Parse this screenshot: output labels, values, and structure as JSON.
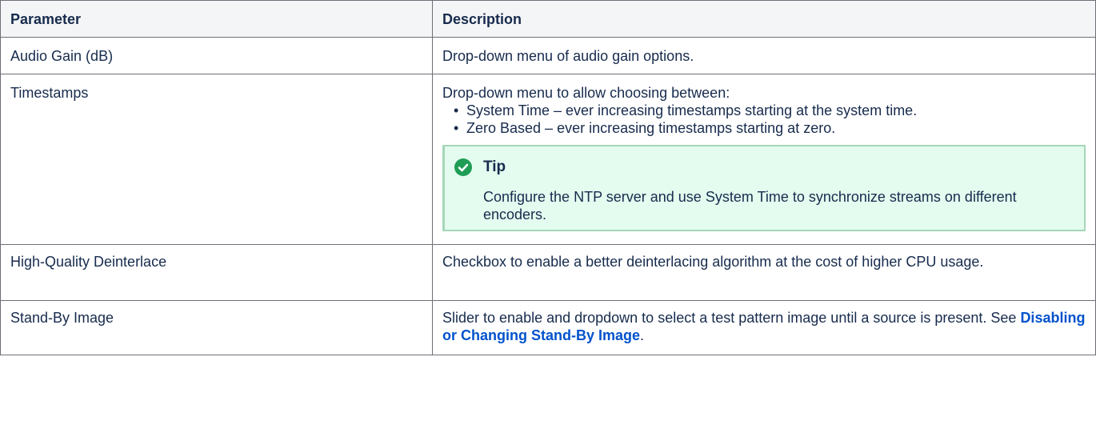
{
  "table": {
    "headers": [
      "Parameter",
      "Description"
    ],
    "rows": {
      "audio_gain": {
        "parameter": "Audio Gain (dB)",
        "description": "Drop-down menu of audio gain options."
      },
      "timestamps": {
        "parameter": "Timestamps",
        "intro": "Drop-down menu to allow choosing between:",
        "options": [
          "System Time – ever increasing timestamps starting at the system time.",
          "Zero Based – ever increasing timestamps starting at zero."
        ],
        "tip": {
          "title": "Tip",
          "body": "Configure the NTP server and use System Time to synchronize streams on different encoders.",
          "icon": "check-circle-icon",
          "color": "#1f9d55"
        }
      },
      "hq_deinterlace": {
        "parameter": "High-Quality Deinterlace",
        "description": "Checkbox to enable a better deinterlacing algorithm at the cost of higher CPU usage."
      },
      "standby_image": {
        "parameter": "Stand-By Image",
        "description_prefix": "Slider to enable and dropdown to select a test pattern image until a source is present. See ",
        "link_text": "Disabling or Changing Stand-By Image",
        "description_suffix": "."
      }
    }
  },
  "colors": {
    "link": "#0052cc",
    "header_bg": "#f4f5f7",
    "tip_bg": "#e3fcef",
    "tip_border": "#a5d6b8"
  }
}
